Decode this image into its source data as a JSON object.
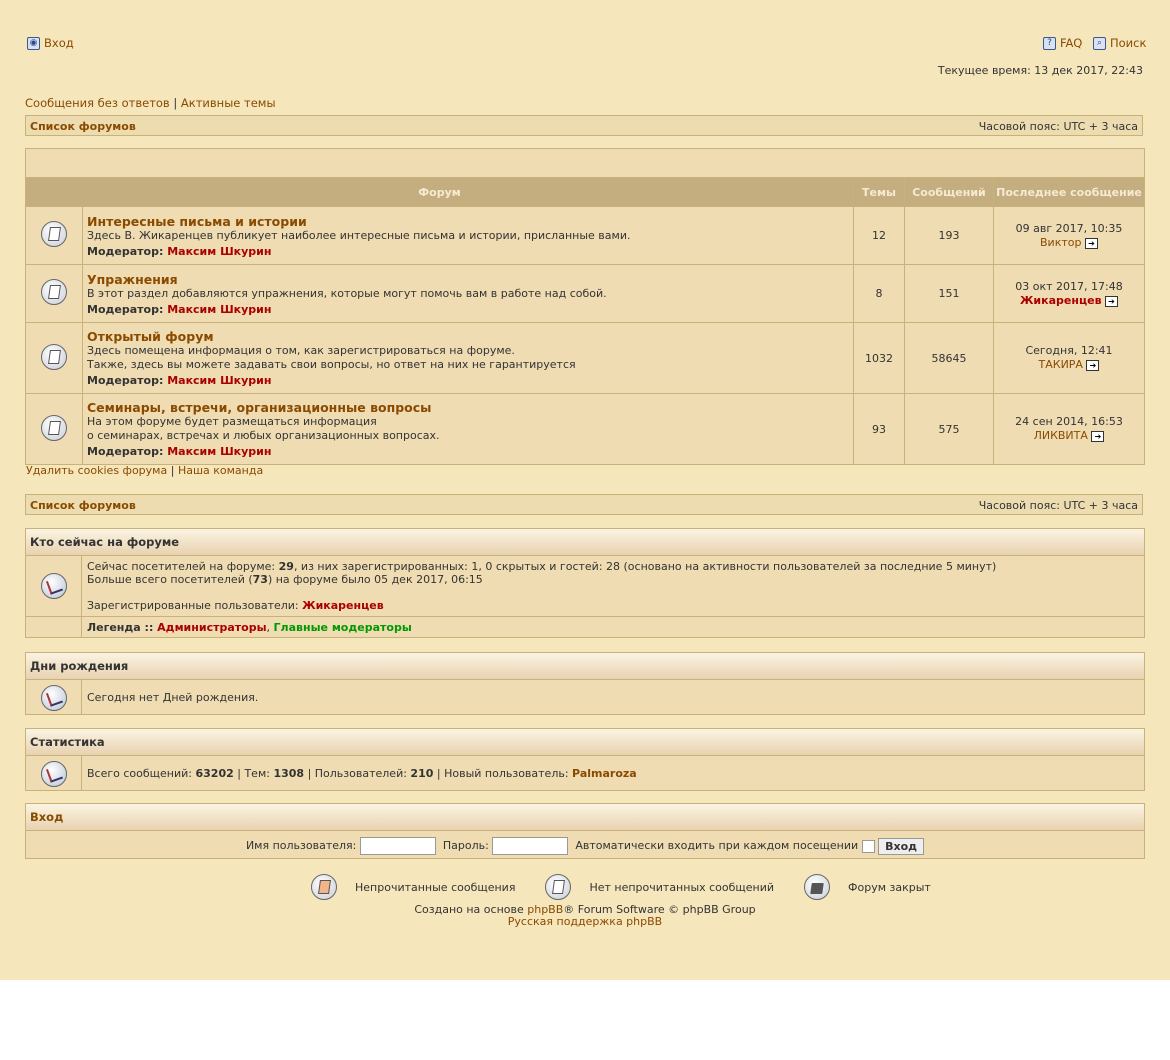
{
  "header": {
    "login_label": "Вход",
    "faq_label": "FAQ",
    "search_label": "Поиск",
    "current_time": "Текущее время: 13 дек 2017, 22:43",
    "unanswered_label": "Сообщения без ответов",
    "active_label": "Активные темы",
    "sep": "|"
  },
  "navbar": {
    "forum_index": "Список форумов",
    "timezone": "Часовой пояс: UTC + 3 часа"
  },
  "forum_table": {
    "col_forum": "Форум",
    "col_topics": "Темы",
    "col_posts": "Сообщений",
    "col_last": "Последнее сообщение",
    "moderator_label": "Модератор:",
    "forums": [
      {
        "title": "Интересные письма и истории",
        "desc": [
          "Здесь В. Жикаренцев публикует наиболее интересные письма и истории, присланные вами."
        ],
        "moderator": "Максим Шкурин",
        "topics": "12",
        "posts": "193",
        "last_date": "09 авг 2017, 10:35",
        "last_user": "Виктор",
        "last_user_red": false
      },
      {
        "title": "Упражнения",
        "desc": [
          "В этот раздел добавляются упражнения, которые могут помочь вам в работе над собой."
        ],
        "moderator": "Максим Шкурин",
        "topics": "8",
        "posts": "151",
        "last_date": "03 окт 2017, 17:48",
        "last_user": "Жикаренцев",
        "last_user_red": true
      },
      {
        "title": "Открытый форум",
        "desc": [
          "Здесь помещена информация о том, как зарегистрироваться на форуме.",
          "Также, здесь вы можете задавать свои вопросы, но ответ на них не гарантируется"
        ],
        "moderator": "Максим Шкурин",
        "topics": "1032",
        "posts": "58645",
        "last_date": "Сегодня, 12:41",
        "last_user": "ТАКИРА",
        "last_user_red": false
      },
      {
        "title": "Семинары, встречи, организационные вопросы",
        "desc": [
          "На этом форуме будет размещаться информация",
          "о семинарах, встречах и любых организационных вопросах."
        ],
        "moderator": "Максим Шкурин",
        "topics": "93",
        "posts": "575",
        "last_date": "24 сен 2014, 16:53",
        "last_user": "ЛИКВИТА",
        "last_user_red": false
      }
    ]
  },
  "bottom_links": {
    "delete_cookies": "Удалить cookies форума",
    "team": "Наша команда",
    "sep": "|"
  },
  "who_online": {
    "title": "Кто сейчас на форуме",
    "line1_a": "Сейчас посетителей на форуме: ",
    "line1_total": "29",
    "line1_b": ", из них зарегистрированных: 1, 0 скрытых и гостей: 28 (основано на активности пользователей за последние 5 минут)",
    "line2_a": "Больше всего посетителей (",
    "line2_max": "73",
    "line2_b": ") на форуме было 05 дек 2017, 06:15",
    "registered_label": "Зарегистрированные пользователи: ",
    "registered_user": "Жикаренцев",
    "legend_label": "Легенда :: ",
    "legend_admins": "Администраторы",
    "legend_comma": ", ",
    "legend_gmods": "Главные модераторы"
  },
  "birthdays": {
    "title": "Дни рождения",
    "text": "Сегодня нет Дней рождения."
  },
  "statistics": {
    "title": "Статистика",
    "posts_label": "Всего сообщений: ",
    "posts": "63202",
    "topics_label": " | Тем: ",
    "topics": "1308",
    "users_label": " | Пользователей: ",
    "users": "210",
    "new_user_label": " | Новый пользователь: ",
    "new_user": "Palmaroza"
  },
  "login_box": {
    "title": "Вход",
    "username_label": "Имя пользователя:",
    "password_label": "Пароль:",
    "auto_label": "Автоматически входить при каждом посещении",
    "submit_label": "Вход"
  },
  "legend_icons": {
    "unread": "Непрочитанные сообщения",
    "no_unread": "Нет непрочитанных сообщений",
    "locked": "Форум закрыт"
  },
  "footer": {
    "created_a": "Создано на основе ",
    "phpbb": "phpBB",
    "created_b": "® Forum Software © phpBB Group",
    "russian": "Русская поддержка phpBB"
  }
}
